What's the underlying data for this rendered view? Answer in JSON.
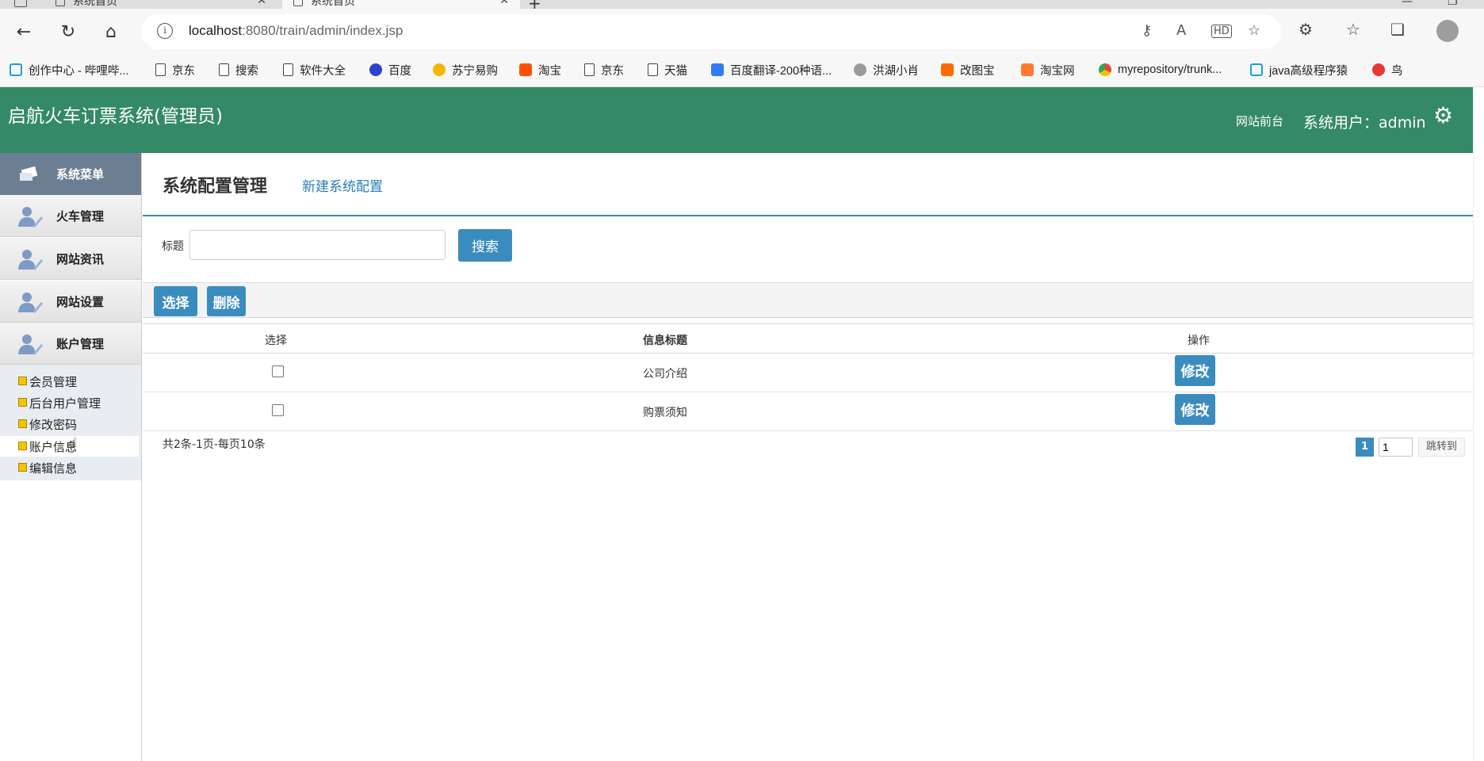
{
  "browser": {
    "tabs": [
      {
        "title": "系统首页",
        "active": false
      },
      {
        "title": "系统首页",
        "active": true
      }
    ],
    "url_host": "localhost",
    "url_rest": ":8080/train/admin/index.jsp",
    "bookmarks": [
      {
        "label": "创作中心 - 哔哩哔...",
        "icon": "bilibili-icon",
        "color": "#1da1d8"
      },
      {
        "label": "京东",
        "icon": "page-icon"
      },
      {
        "label": "搜索",
        "icon": "page-icon"
      },
      {
        "label": "软件大全",
        "icon": "page-icon"
      },
      {
        "label": "百度",
        "icon": "baidu-paw-icon",
        "color": "#2e3fd1"
      },
      {
        "label": "苏宁易购",
        "icon": "suning-lion-icon",
        "color": "#f7b500"
      },
      {
        "label": "淘宝",
        "icon": "taobao-icon",
        "color": "#ff5000"
      },
      {
        "label": "京东",
        "icon": "page-icon"
      },
      {
        "label": "天猫",
        "icon": "page-icon"
      },
      {
        "label": "百度翻译-200种语...",
        "icon": "baidu-translate-icon",
        "color": "#2f7cf6"
      },
      {
        "label": "洪湖小肖",
        "icon": "bird-icon",
        "color": "#777777"
      },
      {
        "label": "改图宝",
        "icon": "gaitubao-icon",
        "color": "#ff6a00"
      },
      {
        "label": "淘宝网",
        "icon": "taobao-icon",
        "color": "#ff5000"
      },
      {
        "label": "myrepository/trunk...",
        "icon": "chrome-icon",
        "color": "#4285f4"
      },
      {
        "label": "java高级程序猿",
        "icon": "bilibili-icon",
        "color": "#1da1d8"
      },
      {
        "label": "鸟",
        "icon": "bird-red-icon",
        "color": "#e53935"
      }
    ]
  },
  "header": {
    "title": "启航火车订票系统(管理员)",
    "front_link": "网站前台",
    "user_label": "系统用户：admin"
  },
  "sidebar": {
    "head": "系统菜单",
    "items": [
      {
        "label": "火车管理"
      },
      {
        "label": "网站资讯"
      },
      {
        "label": "网站设置"
      },
      {
        "label": "账户管理"
      }
    ],
    "sub_items": [
      {
        "label": "会员管理",
        "active": false
      },
      {
        "label": "后台用户管理",
        "active": false
      },
      {
        "label": "修改密码",
        "active": false
      },
      {
        "label": "账户信息",
        "active": true
      },
      {
        "label": "编辑信息",
        "active": false
      }
    ]
  },
  "main": {
    "title": "系统配置管理",
    "new_link": "新建系统配置",
    "search": {
      "label": "标题",
      "value": "",
      "button": "搜索"
    },
    "toolbar": {
      "select": "选择",
      "delete": "删除"
    },
    "table": {
      "headers": [
        "选择",
        "信息标题",
        "操作"
      ],
      "rows": [
        {
          "title": "公司介绍",
          "action": "修改"
        },
        {
          "title": "购票须知",
          "action": "修改"
        }
      ]
    },
    "pager": {
      "summary": "共2条-1页-每页10条",
      "current": "1",
      "input": "1",
      "go": "跳转到"
    }
  },
  "colors": {
    "header_bg": "#348968",
    "accent_blue": "#3a8cbf",
    "sidebar_head": "#6c7e92",
    "link": "#2a7fb3"
  }
}
